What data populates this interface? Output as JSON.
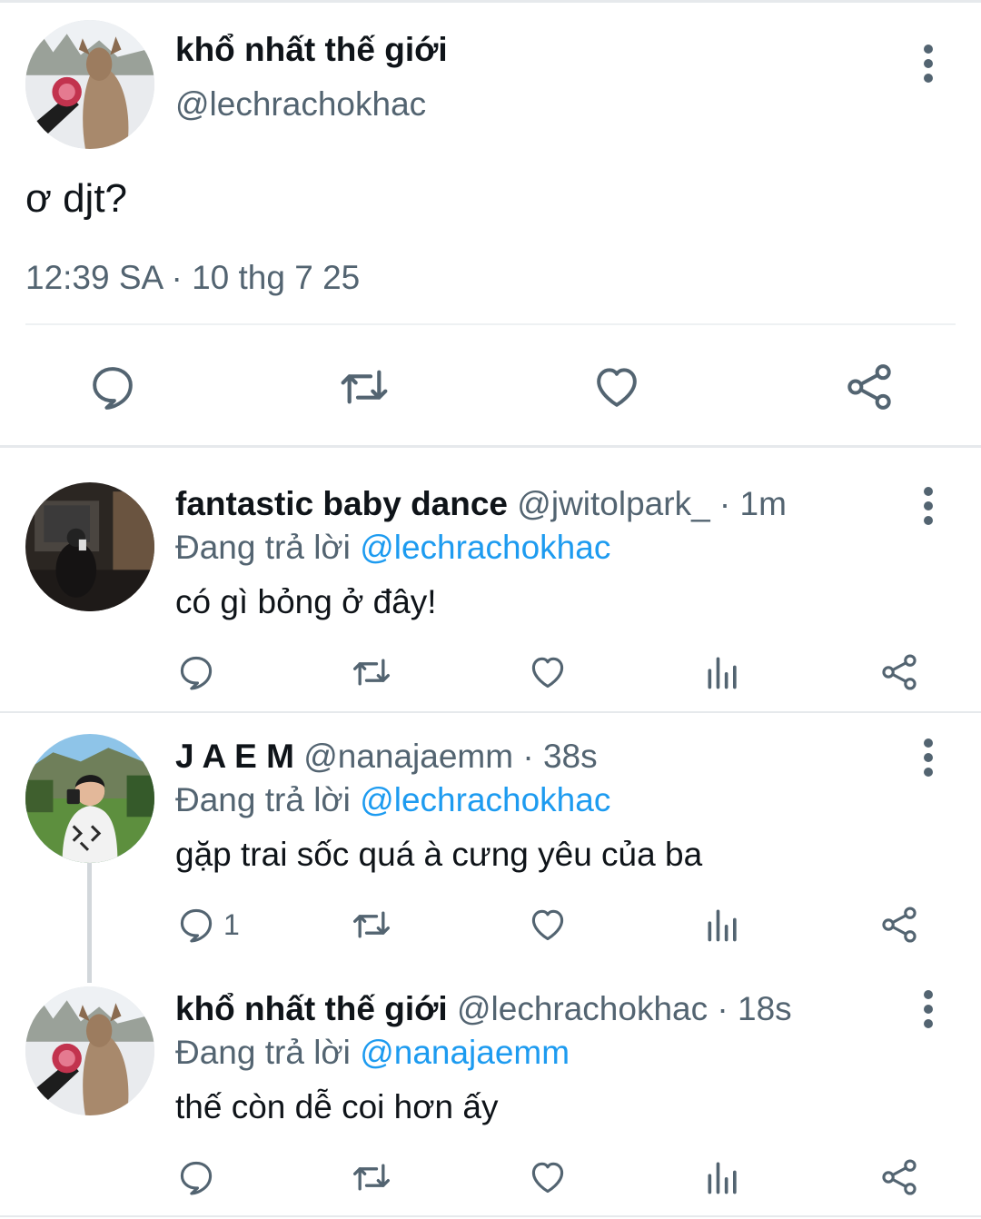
{
  "main_tweet": {
    "display_name": "khổ nhất thế giới",
    "handle": "@lechrachokhac",
    "text": "ơ djt?",
    "timestamp": "12:39 SA · 10 thg 7 25",
    "actions": [
      "reply-icon",
      "retweet-icon",
      "like-icon",
      "share-icon"
    ]
  },
  "replies": [
    {
      "display_name": "fantastic baby dance",
      "handle": "@jwitolpark_",
      "time": " · 1m",
      "replying_prefix": "Đang trả lời ",
      "replying_to": "@lechrachokhac",
      "text": "có gì bỏng ở đây!",
      "reply_count": ""
    },
    {
      "display_name": "J A E M",
      "handle": "@nanajaemm",
      "time": " · 38s",
      "replying_prefix": "Đang trả lời ",
      "replying_to": "@lechrachokhac",
      "text": "gặp trai sốc quá à cưng yêu của ba",
      "reply_count": "1"
    },
    {
      "display_name": "khổ nhất thế giới",
      "handle": "@lechrachokhac",
      "time": " · 18s",
      "replying_prefix": "Đang trả lời ",
      "replying_to": "@nanajaemm",
      "text": "thế còn dễ coi hơn ấy",
      "reply_count": ""
    }
  ],
  "colors": {
    "text": "#0f1419",
    "secondary": "#536471",
    "link": "#1d9bf0",
    "divider": "#e6e9ec"
  }
}
